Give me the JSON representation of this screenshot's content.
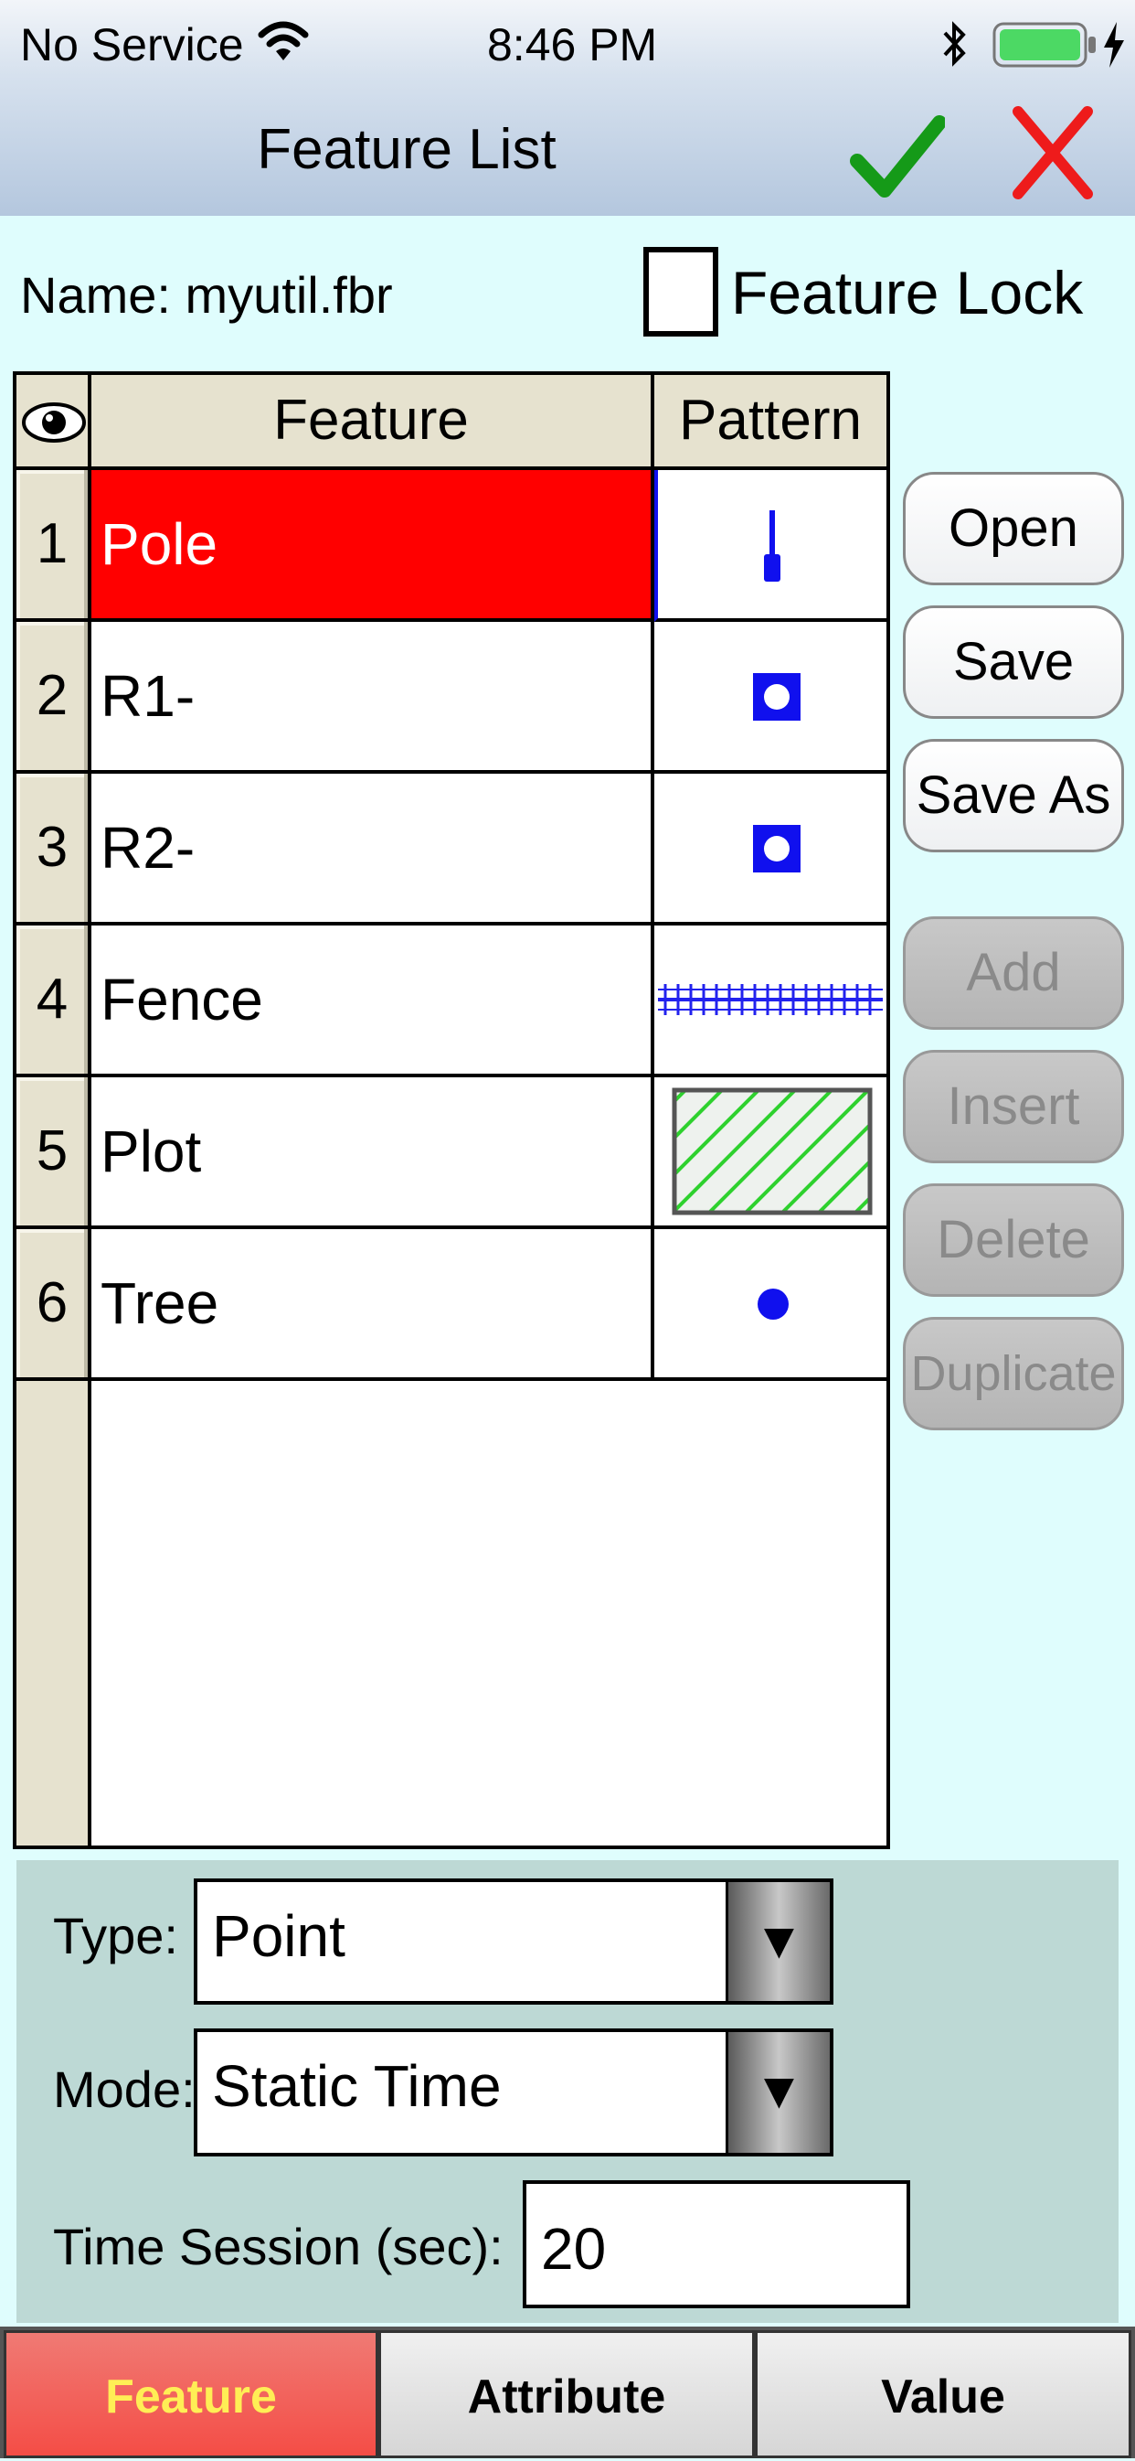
{
  "status_bar": {
    "carrier": "No Service",
    "time": "8:46 PM",
    "icons": [
      "wifi-icon",
      "bluetooth-icon",
      "battery-icon",
      "charging-bolt-icon"
    ]
  },
  "nav": {
    "title": "Feature List",
    "confirm_icon": "checkmark-icon",
    "cancel_icon": "close-x-icon",
    "colors": {
      "confirm": "#159a18",
      "cancel": "#ee1b1b"
    }
  },
  "file": {
    "name_label": "Name: myutil.fbr",
    "lock_label": "Feature Lock",
    "lock_checked": false
  },
  "table": {
    "visibility_icon": "eye-icon",
    "headers": {
      "feature": "Feature",
      "pattern": "Pattern"
    },
    "rows": [
      {
        "num": "1",
        "feature": "Pole",
        "pattern": "pole-point-icon",
        "selected": true
      },
      {
        "num": "2",
        "feature": "R1-",
        "pattern": "hollow-square-icon"
      },
      {
        "num": "3",
        "feature": "R2-",
        "pattern": "hollow-square-icon"
      },
      {
        "num": "4",
        "feature": "Fence",
        "pattern": "fence-line-icon"
      },
      {
        "num": "5",
        "feature": "Plot",
        "pattern": "hatched-area-icon"
      },
      {
        "num": "6",
        "feature": "Tree",
        "pattern": "dot-point-icon"
      }
    ],
    "selected_color": "#ff0000",
    "pattern_color": "#1010ee"
  },
  "side_buttons": {
    "open": "Open",
    "save": "Save",
    "save_as": "Save As",
    "add": "Add",
    "insert": "Insert",
    "delete": "Delete",
    "duplicate": "Duplicate"
  },
  "properties": {
    "type_label": "Type:",
    "type_value": "Point",
    "mode_label": "Mode:",
    "mode_value": "Static Time",
    "session_label": "Time Session (sec):",
    "session_value": "20"
  },
  "tabs": {
    "feature": "Feature",
    "attribute": "Attribute",
    "value": "Value",
    "active": "feature"
  }
}
